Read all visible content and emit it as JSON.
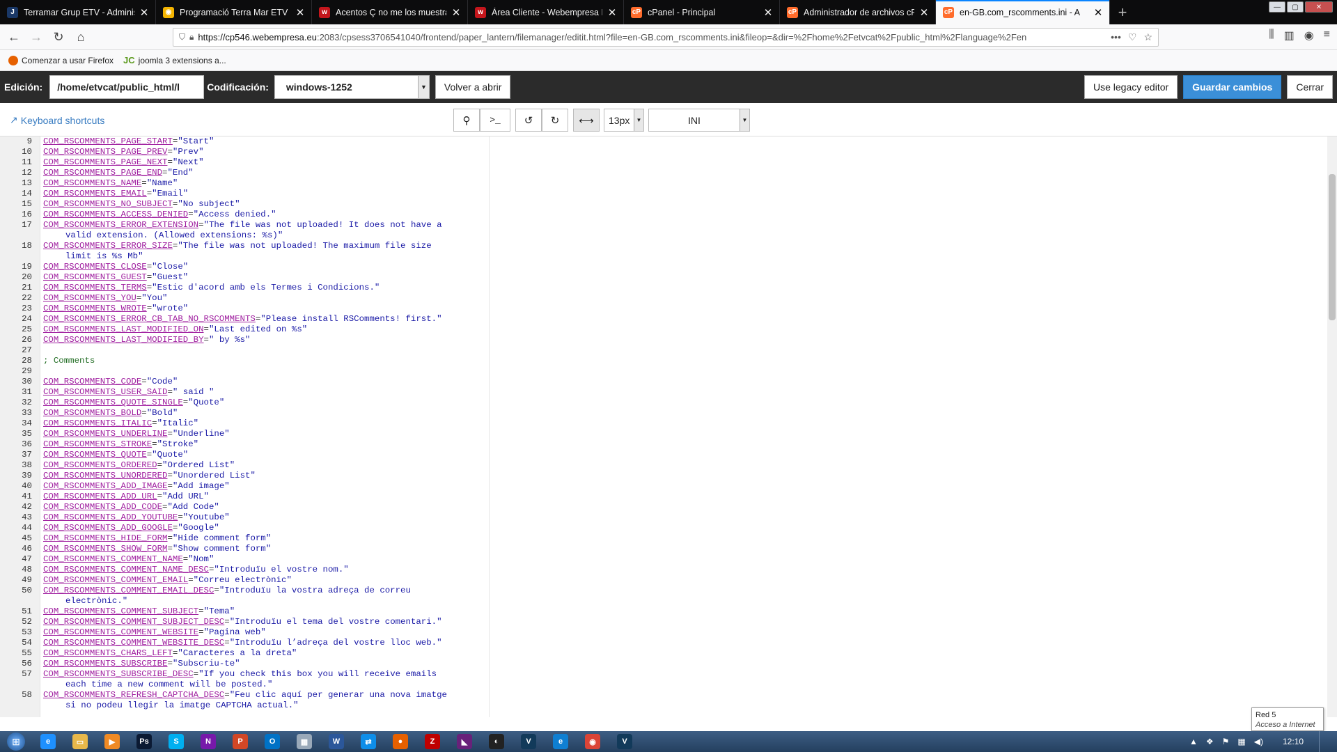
{
  "browser": {
    "tabs": [
      {
        "title": "Terramar Grup ETV - Administ",
        "icon": "joomla-icon",
        "color": "#1a3867",
        "glyph": "J",
        "active": false
      },
      {
        "title": "Programació Terra Mar ETV",
        "icon": "chrome-icon",
        "color": "#f4b400",
        "glyph": "◉",
        "active": false
      },
      {
        "title": "Acentos Ç no me los muestra -",
        "icon": "webempresa-icon",
        "color": "#c4161c",
        "glyph": "w",
        "active": false
      },
      {
        "title": "Área Cliente - Webempresa Eur",
        "icon": "webempresa-icon",
        "color": "#c4161c",
        "glyph": "w",
        "active": false
      },
      {
        "title": "cPanel - Principal",
        "icon": "cpanel-icon",
        "color": "#ff6c2c",
        "glyph": "cP",
        "active": false
      },
      {
        "title": "Administrador de archivos cPa",
        "icon": "cpanel-icon",
        "color": "#ff6c2c",
        "glyph": "cP",
        "active": false
      },
      {
        "title": "en-GB.com_rscomments.ini - A",
        "icon": "cpanel-icon",
        "color": "#ff6c2c",
        "glyph": "cP",
        "active": true
      }
    ],
    "url_host": "https://cp546.webempresa.eu",
    "url_rest": ":2083/cpsess3706541040/frontend/paper_lantern/filemanager/editit.html?file=en-GB.com_rscomments.ini&fileop=&dir=%2Fhome%2Fetvcat%2Fpublic_html%2Flanguage%2Fen",
    "bookmarks": [
      {
        "label": "Comenzar a usar Firefox",
        "icon": "firefox-icon"
      },
      {
        "label": "joomla 3 extensions a...",
        "icon": "jc-icon",
        "glyph": "JC"
      }
    ]
  },
  "editor": {
    "edit_label": "Edición:",
    "path_value": "/home/etvcat/public_html/l",
    "encoding_label": "Codificación:",
    "encoding_value": "windows-1252",
    "reopen_label": "Volver a abrir",
    "legacy_label": "Use legacy editor",
    "save_label": "Guardar cambios",
    "close_label": "Cerrar",
    "shortcuts_label": "Keyboard shortcuts",
    "font_size": "13px",
    "mode": "INI"
  },
  "code": [
    {
      "n": "9",
      "k": "COM_RSCOMMENTS_PAGE_START",
      "v": "\"Start\""
    },
    {
      "n": "10",
      "k": "COM_RSCOMMENTS_PAGE_PREV",
      "v": "\"Prev\""
    },
    {
      "n": "11",
      "k": "COM_RSCOMMENTS_PAGE_NEXT",
      "v": "\"Next\""
    },
    {
      "n": "12",
      "k": "COM_RSCOMMENTS_PAGE_END",
      "v": "\"End\""
    },
    {
      "n": "13",
      "k": "COM_RSCOMMENTS_NAME",
      "v": "\"Name\""
    },
    {
      "n": "14",
      "k": "COM_RSCOMMENTS_EMAIL",
      "v": "\"Email\""
    },
    {
      "n": "15",
      "k": "COM_RSCOMMENTS_NO_SUBJECT",
      "v": "\"No subject\""
    },
    {
      "n": "16",
      "k": "COM_RSCOMMENTS_ACCESS_DENIED",
      "v": "\"Access denied.\""
    },
    {
      "n": "17",
      "k": "COM_RSCOMMENTS_ERROR_EXTENSION",
      "v": "\"The file was not uploaded! It does not have a",
      "c": "valid extension. (Allowed extensions: %s)\""
    },
    {
      "n": "18",
      "k": "COM_RSCOMMENTS_ERROR_SIZE",
      "v": "\"The file was not uploaded! The maximum file size",
      "c": "limit is %s Mb\""
    },
    {
      "n": "19",
      "k": "COM_RSCOMMENTS_CLOSE",
      "v": "\"Close\""
    },
    {
      "n": "20",
      "k": "COM_RSCOMMENTS_GUEST",
      "v": "\"Guest\""
    },
    {
      "n": "21",
      "k": "COM_RSCOMMENTS_TERMS",
      "v": "\"Estic d'acord amb els Termes i Condicions.\""
    },
    {
      "n": "22",
      "k": "COM_RSCOMMENTS_YOU",
      "v": "\"You\""
    },
    {
      "n": "23",
      "k": "COM_RSCOMMENTS_WROTE",
      "v": "\"wrote\""
    },
    {
      "n": "24",
      "k": "COM_RSCOMMENTS_ERROR_CB_TAB_NO_RSCOMMENTS",
      "v": "\"Please install RSComments! first.\""
    },
    {
      "n": "25",
      "k": "COM_RSCOMMENTS_LAST_MODIFIED_ON",
      "v": "\"Last edited on %s\""
    },
    {
      "n": "26",
      "k": "COM_RSCOMMENTS_LAST_MODIFIED_BY",
      "v": "\" by %s\""
    },
    {
      "n": "27",
      "k": "",
      "v": ""
    },
    {
      "n": "28",
      "comment": "; Comments"
    },
    {
      "n": "29",
      "k": "",
      "v": ""
    },
    {
      "n": "30",
      "k": "COM_RSCOMMENTS_CODE",
      "v": "\"Code\""
    },
    {
      "n": "31",
      "k": "COM_RSCOMMENTS_USER_SAID",
      "v": "\" said \""
    },
    {
      "n": "32",
      "k": "COM_RSCOMMENTS_QUOTE_SINGLE",
      "v": "\"Quote\""
    },
    {
      "n": "33",
      "k": "COM_RSCOMMENTS_BOLD",
      "v": "\"Bold\""
    },
    {
      "n": "34",
      "k": "COM_RSCOMMENTS_ITALIC",
      "v": "\"Italic\""
    },
    {
      "n": "35",
      "k": "COM_RSCOMMENTS_UNDERLINE",
      "v": "\"Underline\""
    },
    {
      "n": "36",
      "k": "COM_RSCOMMENTS_STROKE",
      "v": "\"Stroke\""
    },
    {
      "n": "37",
      "k": "COM_RSCOMMENTS_QUOTE",
      "v": "\"Quote\""
    },
    {
      "n": "38",
      "k": "COM_RSCOMMENTS_ORDERED",
      "v": "\"Ordered List\""
    },
    {
      "n": "39",
      "k": "COM_RSCOMMENTS_UNORDERED",
      "v": "\"Unordered List\""
    },
    {
      "n": "40",
      "k": "COM_RSCOMMENTS_ADD_IMAGE",
      "v": "\"Add image\""
    },
    {
      "n": "41",
      "k": "COM_RSCOMMENTS_ADD_URL",
      "v": "\"Add URL\""
    },
    {
      "n": "42",
      "k": "COM_RSCOMMENTS_ADD_CODE",
      "v": "\"Add Code\""
    },
    {
      "n": "43",
      "k": "COM_RSCOMMENTS_ADD_YOUTUBE",
      "v": "\"Youtube\""
    },
    {
      "n": "44",
      "k": "COM_RSCOMMENTS_ADD_GOOGLE",
      "v": "\"Google\""
    },
    {
      "n": "45",
      "k": "COM_RSCOMMENTS_HIDE_FORM",
      "v": "\"Hide comment form\""
    },
    {
      "n": "46",
      "k": "COM_RSCOMMENTS_SHOW_FORM",
      "v": "\"Show comment form\""
    },
    {
      "n": "47",
      "k": "COM_RSCOMMENTS_COMMENT_NAME",
      "v": "\"Nom\""
    },
    {
      "n": "48",
      "k": "COM_RSCOMMENTS_COMMENT_NAME_DESC",
      "v": "\"Introduïu el vostre nom.\""
    },
    {
      "n": "49",
      "k": "COM_RSCOMMENTS_COMMENT_EMAIL",
      "v": "\"Correu electrònic\""
    },
    {
      "n": "50",
      "k": "COM_RSCOMMENTS_COMMENT_EMAIL_DESC",
      "v": "\"Introduïu la vostra adreça de correu",
      "c": "electrònic.\""
    },
    {
      "n": "51",
      "k": "COM_RSCOMMENTS_COMMENT_SUBJECT",
      "v": "\"Tema\""
    },
    {
      "n": "52",
      "k": "COM_RSCOMMENTS_COMMENT_SUBJECT_DESC",
      "v": "\"Introduïu el tema del vostre comentari.\""
    },
    {
      "n": "53",
      "k": "COM_RSCOMMENTS_COMMENT_WEBSITE",
      "v": "\"Pagina web\""
    },
    {
      "n": "54",
      "k": "COM_RSCOMMENTS_COMMENT_WEBSITE_DESC",
      "v": "\"Introduïu l’adreça del vostre lloc web.\""
    },
    {
      "n": "55",
      "k": "COM_RSCOMMENTS_CHARS_LEFT",
      "v": "\"Caracteres a la dreta\""
    },
    {
      "n": "56",
      "k": "COM_RSCOMMENTS_SUBSCRIBE",
      "v": "\"Subscriu-te\""
    },
    {
      "n": "57",
      "k": "COM_RSCOMMENTS_SUBSCRIBE_DESC",
      "v": "\"If you check this box you will receive emails",
      "c": "each time a new comment will be posted.\""
    },
    {
      "n": "58",
      "k": "COM_RSCOMMENTS_REFRESH_CAPTCHA_DESC",
      "v": "\"Feu clic aquí per generar una nova imatge",
      "c": "si no podeu llegir la imatge CAPTCHA actual.\""
    }
  ],
  "status_tooltip": {
    "line1": "Red  5",
    "line2": "Acceso a Internet"
  },
  "taskbar": {
    "apps": [
      {
        "icon": "ie-icon",
        "color": "#1e90ff",
        "glyph": "e"
      },
      {
        "icon": "folder-icon",
        "color": "#e8b84a",
        "glyph": "▭"
      },
      {
        "icon": "media-player-icon",
        "color": "#f08a24",
        "glyph": "▶"
      },
      {
        "icon": "photoshop-icon",
        "color": "#0b1a33",
        "glyph": "Ps"
      },
      {
        "icon": "skype-icon",
        "color": "#00aff0",
        "glyph": "S"
      },
      {
        "icon": "onenote-icon",
        "color": "#7719aa",
        "glyph": "N"
      },
      {
        "icon": "powerpoint-icon",
        "color": "#d24726",
        "glyph": "P"
      },
      {
        "icon": "outlook-icon",
        "color": "#0072c6",
        "glyph": "O"
      },
      {
        "icon": "calculator-icon",
        "color": "#9aa9b9",
        "glyph": "▦"
      },
      {
        "icon": "word-icon",
        "color": "#2b579a",
        "glyph": "W"
      },
      {
        "icon": "teamviewer-icon",
        "color": "#0e8ee9",
        "glyph": "⇄"
      },
      {
        "icon": "firefox-icon",
        "color": "#e66000",
        "glyph": "●"
      },
      {
        "icon": "filezilla-icon",
        "color": "#bf0000",
        "glyph": "Z"
      },
      {
        "icon": "visual-studio-icon",
        "color": "#68217a",
        "glyph": "◣"
      },
      {
        "icon": "app-icon",
        "color": "#222222",
        "glyph": "◐"
      },
      {
        "icon": "vectorworks-icon",
        "color": "#123a5a",
        "glyph": "V"
      },
      {
        "icon": "edge-icon",
        "color": "#0f7fd2",
        "glyph": "e"
      },
      {
        "icon": "chrome-icon",
        "color": "#db4437",
        "glyph": "◉"
      },
      {
        "icon": "vectorworks-icon",
        "color": "#123a5a",
        "glyph": "V"
      }
    ],
    "clock": "12:10"
  }
}
